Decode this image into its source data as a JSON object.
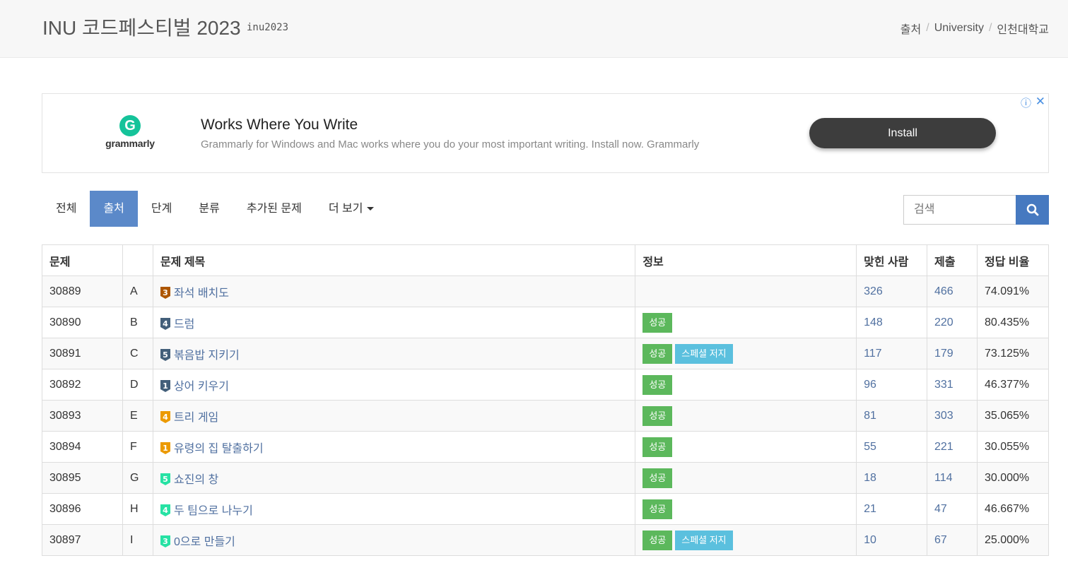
{
  "header": {
    "title": "INU 코드페스티벌 2023",
    "subtitle": "inu2023",
    "breadcrumb": [
      "출처",
      "University",
      "인천대학교"
    ]
  },
  "ad": {
    "brand": "grammarly",
    "headline": "Works Where You Write",
    "description": "Grammarly for Windows and Mac works where you do your most important writing. Install now. Grammarly",
    "install_label": "Install"
  },
  "tabs": [
    {
      "label": "전체"
    },
    {
      "label": "출처",
      "active": true
    },
    {
      "label": "단계"
    },
    {
      "label": "분류"
    },
    {
      "label": "추가된 문제"
    },
    {
      "label": "더 보기",
      "dropdown": true
    }
  ],
  "search": {
    "placeholder": "검색"
  },
  "table": {
    "headers": [
      "문제",
      "",
      "문제 제목",
      "정보",
      "맞힌 사람",
      "제출",
      "정답 비율"
    ],
    "rows": [
      {
        "id": "30889",
        "letter": "A",
        "tier": "3",
        "tier_color": "#ad5600",
        "title": "좌석 배치도",
        "info": [],
        "solved": "326",
        "submissions": "466",
        "ratio": "74.091%"
      },
      {
        "id": "30890",
        "letter": "B",
        "tier": "4",
        "tier_color": "#435f7a",
        "title": "드럼",
        "info": [
          "성공"
        ],
        "solved": "148",
        "submissions": "220",
        "ratio": "80.435%"
      },
      {
        "id": "30891",
        "letter": "C",
        "tier": "5",
        "tier_color": "#435f7a",
        "title": "볶음밥 지키기",
        "info": [
          "성공",
          "스페셜 저지"
        ],
        "solved": "117",
        "submissions": "179",
        "ratio": "73.125%"
      },
      {
        "id": "30892",
        "letter": "D",
        "tier": "1",
        "tier_color": "#435f7a",
        "title": "상어 키우기",
        "info": [
          "성공"
        ],
        "solved": "96",
        "submissions": "331",
        "ratio": "46.377%"
      },
      {
        "id": "30893",
        "letter": "E",
        "tier": "4",
        "tier_color": "#ec9a00",
        "title": "트리 게임",
        "info": [
          "성공"
        ],
        "solved": "81",
        "submissions": "303",
        "ratio": "35.065%"
      },
      {
        "id": "30894",
        "letter": "F",
        "tier": "1",
        "tier_color": "#ec9a00",
        "title": "유령의 집 탈출하기",
        "info": [
          "성공"
        ],
        "solved": "55",
        "submissions": "221",
        "ratio": "30.055%"
      },
      {
        "id": "30895",
        "letter": "G",
        "tier": "5",
        "tier_color": "#27e2a4",
        "title": "쇼진의 창",
        "info": [
          "성공"
        ],
        "solved": "18",
        "submissions": "114",
        "ratio": "30.000%"
      },
      {
        "id": "30896",
        "letter": "H",
        "tier": "4",
        "tier_color": "#27e2a4",
        "title": "두 팀으로 나누기",
        "info": [
          "성공"
        ],
        "solved": "21",
        "submissions": "47",
        "ratio": "46.667%"
      },
      {
        "id": "30897",
        "letter": "I",
        "tier": "3",
        "tier_color": "#27e2a4",
        "title": "0으로 만들기",
        "info": [
          "성공",
          "스페셜 저지"
        ],
        "solved": "10",
        "submissions": "67",
        "ratio": "25.000%"
      }
    ]
  }
}
